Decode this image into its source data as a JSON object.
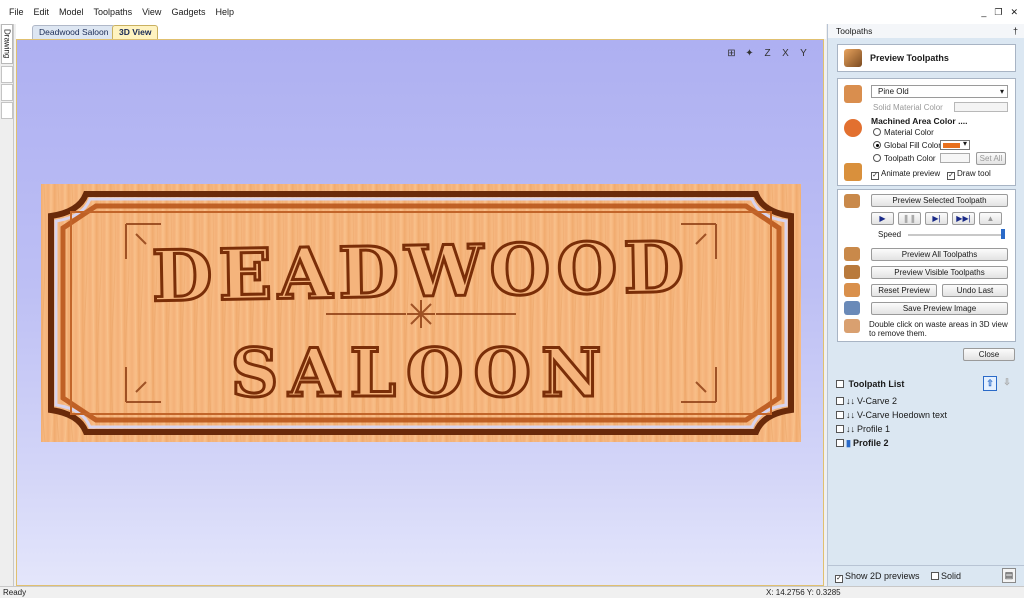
{
  "menu": [
    "File",
    "Edit",
    "Model",
    "Toolpaths",
    "View",
    "Gadgets",
    "Help"
  ],
  "window_controls": {
    "minimize": "_",
    "restore": "❐",
    "close": "✕"
  },
  "left_dock": {
    "drawing_tab": "Drawing"
  },
  "tabs": {
    "doc": "Deadwood Saloon",
    "view3d": "3D View"
  },
  "view_icons": [
    "fit-view-icon",
    "iso-view-icon",
    "z-axis-view-icon",
    "x-axis-view-icon",
    "y-axis-view-icon"
  ],
  "view_icon_glyphs": [
    "⊞",
    "✦",
    "Z",
    "X",
    "Y"
  ],
  "sign": {
    "line1": "DEADWOOD",
    "line2": "SALOON"
  },
  "panel": {
    "title": "Toolpaths",
    "pin": "†",
    "preview_header": "Preview Toolpaths",
    "material": "Pine Old",
    "solid_material_color": "Solid Material Color",
    "machined_area_color": "Machined Area Color ....",
    "radio_material": "Material Color",
    "radio_global": "Global Fill Color",
    "radio_toolpath": "Toolpath Color",
    "set_all": "Set All",
    "animate_preview": "Animate preview",
    "draw_tool": "Draw tool",
    "preview_selected": "Preview Selected Toolpath",
    "speed": "Speed",
    "preview_all": "Preview All Toolpaths",
    "preview_visible": "Preview Visible Toolpaths",
    "reset_preview": "Reset Preview",
    "undo_last": "Undo Last",
    "save_preview": "Save Preview Image",
    "hint": "Double click on waste areas in 3D view to remove them.",
    "close": "Close",
    "global_fill_hex": "#e8701e"
  },
  "toolpath_list": {
    "title": "Toolpath List",
    "items": [
      {
        "name": "V-Carve 2",
        "bold": false
      },
      {
        "name": "V-Carve Hoedown text",
        "bold": false
      },
      {
        "name": "Profile 1",
        "bold": false
      },
      {
        "name": "Profile 2",
        "bold": true
      }
    ]
  },
  "bottom": {
    "show_2d": "Show 2D previews",
    "solid": "Solid"
  },
  "status": {
    "left": "Ready",
    "coords": "X: 14.2756 Y:  0.3285"
  }
}
